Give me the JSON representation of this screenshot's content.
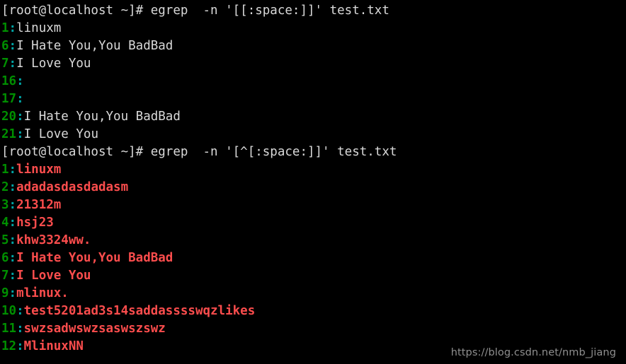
{
  "terminal": {
    "background_color": "#000000",
    "foreground_color": "#d9d9d9",
    "line_number_color": "#008f00",
    "separator_color": "#00a6a6",
    "match_color": "#fc4d4d",
    "prompt": "[root@localhost ~]#",
    "separator": ":"
  },
  "blocks": [
    {
      "command": " egrep  -n '[[:space:]]' test.txt",
      "results": [
        {
          "number": "1",
          "text": "linuxm",
          "highlight": false
        },
        {
          "number": "6",
          "text": "I Hate You,You BadBad",
          "highlight": false
        },
        {
          "number": "7",
          "text": "I Love You",
          "highlight": false
        },
        {
          "number": "16",
          "text": "",
          "highlight": false
        },
        {
          "number": "17",
          "text": "",
          "highlight": false
        },
        {
          "number": "20",
          "text": "I Hate You,You BadBad",
          "highlight": false
        },
        {
          "number": "21",
          "text": "I Love You",
          "highlight": false
        }
      ]
    },
    {
      "command": " egrep  -n '[^[:space:]]' test.txt",
      "results": [
        {
          "number": "1",
          "text": "linuxm",
          "highlight": true
        },
        {
          "number": "2",
          "text": "adadasdasdadasm",
          "highlight": true
        },
        {
          "number": "3",
          "text": "21312m",
          "highlight": true
        },
        {
          "number": "4",
          "text": "hsj23",
          "highlight": true
        },
        {
          "number": "5",
          "text": "khw3324ww.",
          "highlight": true
        },
        {
          "number": "6",
          "text": "I Hate You,You BadBad",
          "highlight": true
        },
        {
          "number": "7",
          "text": "I Love You",
          "highlight": true
        },
        {
          "number": "9",
          "text": "mlinux.",
          "highlight": true
        },
        {
          "number": "10",
          "text": "test5201ad3s14saddasssswqzlikes",
          "highlight": true
        },
        {
          "number": "11",
          "text": "swzsadwswzsaswszswz",
          "highlight": true
        },
        {
          "number": "12",
          "text": "MlinuxNN",
          "highlight": true
        }
      ]
    }
  ],
  "watermark": {
    "text": "https://blog.csdn.net/nmb_jiang"
  }
}
